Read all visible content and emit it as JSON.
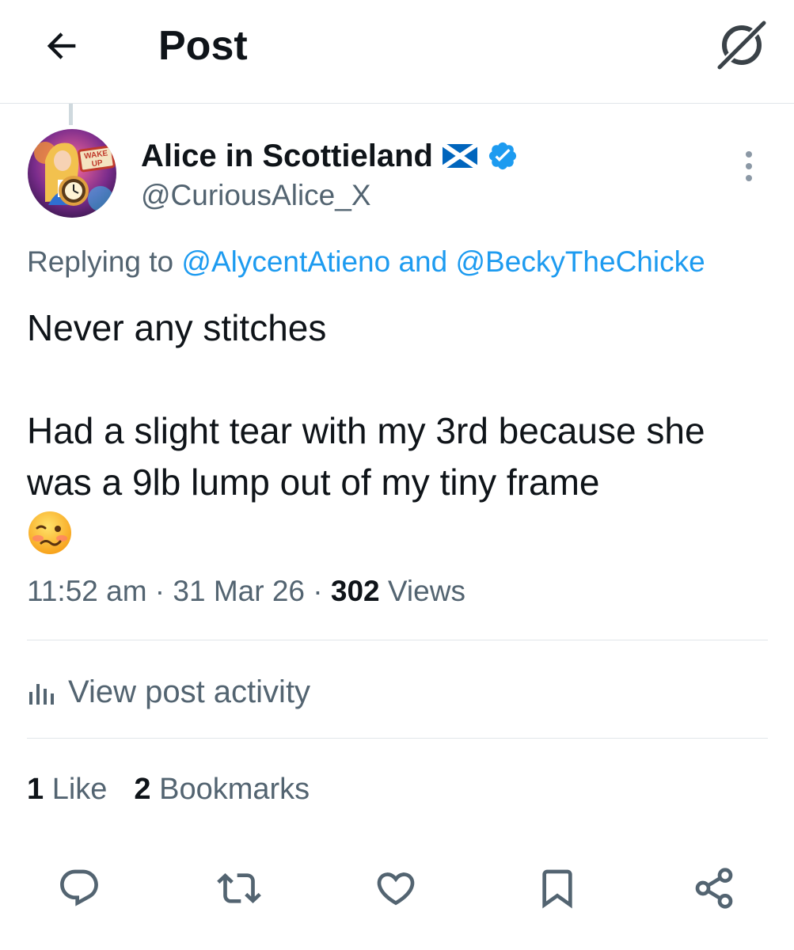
{
  "header": {
    "title": "Post",
    "back_icon": "arrow-left-icon",
    "grok_icon": "grok-icon"
  },
  "author": {
    "display_name": "Alice in Scottieland",
    "flag_icon": "scotland-flag-icon",
    "verified_icon": "verified-badge-icon",
    "handle": "@CuriousAlice_X",
    "avatar_text": "WAKE UP"
  },
  "reply_context": {
    "prefix": "Replying to ",
    "mention_1": "@AlycentAtieno",
    "joiner": " and ",
    "mention_2": "@BeckyTheChicke"
  },
  "post": {
    "paragraph_1": "Never any stitches",
    "paragraph_2": "Had a slight tear with my 3rd because she was a 9lb lump out of my tiny frame",
    "emoji_icon": "woozy-face-emoji"
  },
  "meta": {
    "time": "11:52 am",
    "separator": " · ",
    "date": "31 Mar 26",
    "views_count": "302",
    "views_label": " Views"
  },
  "activity": {
    "label": "View post activity",
    "icon": "bar-chart-icon"
  },
  "stats": {
    "likes_count": "1",
    "likes_label": " Like",
    "bookmarks_count": "2",
    "bookmarks_label": " Bookmarks"
  },
  "actions": [
    "reply-icon",
    "repost-icon",
    "like-icon",
    "bookmark-icon",
    "share-icon"
  ],
  "colors": {
    "accent": "#1d9bf0",
    "secondary_text": "#536471",
    "divider": "#e1e6ea"
  }
}
